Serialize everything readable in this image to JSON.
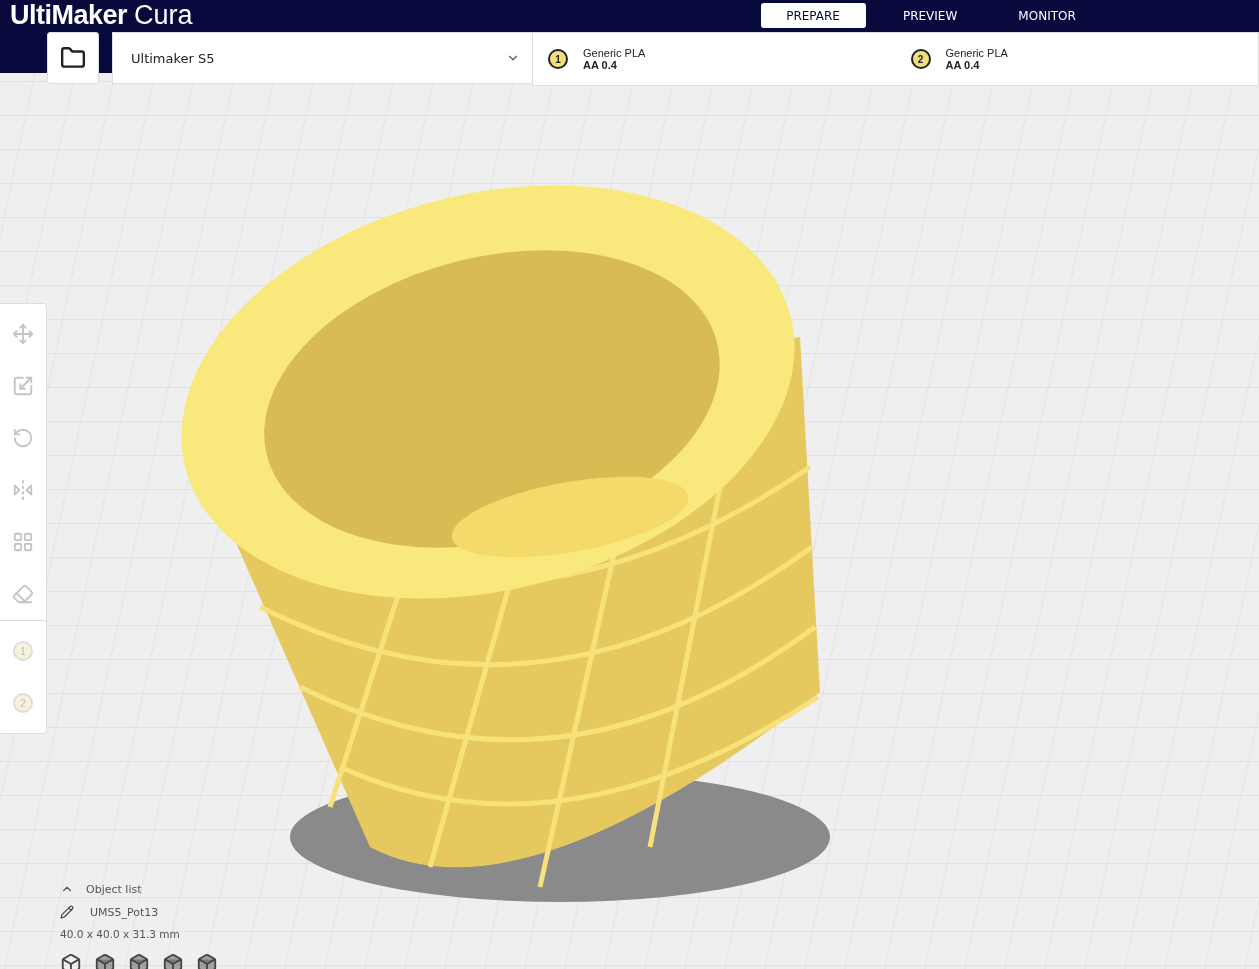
{
  "app": {
    "brand": "UltiMaker",
    "product": "Cura"
  },
  "stages": [
    {
      "label": "PREPARE",
      "selected": true
    },
    {
      "label": "PREVIEW",
      "selected": false
    },
    {
      "label": "MONITOR",
      "selected": false
    }
  ],
  "printer": {
    "name": "Ultimaker S5"
  },
  "extruders": [
    {
      "number": "1",
      "material": "Generic PLA",
      "nozzle": "AA 0.4"
    },
    {
      "number": "2",
      "material": "Generic PLA",
      "nozzle": "AA 0.4"
    }
  ],
  "tools": [
    {
      "kind": "move",
      "disabled": true
    },
    {
      "kind": "scale",
      "disabled": true
    },
    {
      "kind": "rotate",
      "disabled": true
    },
    {
      "kind": "mirror",
      "disabled": true
    },
    {
      "kind": "per-model",
      "disabled": true
    },
    {
      "kind": "support-blocker",
      "disabled": true
    }
  ],
  "extruder_buttons": [
    {
      "number": "1",
      "disabled": true
    },
    {
      "number": "2",
      "disabled": true
    }
  ],
  "object_list": {
    "title": "Object list",
    "expanded": true,
    "object": "UMS5_Pot13",
    "dimensions": "40.0 x 40.0 x 31.3 mm"
  },
  "view_buttons": [
    {
      "kind": "perspective"
    },
    {
      "kind": "front"
    },
    {
      "kind": "top"
    },
    {
      "kind": "left"
    },
    {
      "kind": "right"
    }
  ]
}
